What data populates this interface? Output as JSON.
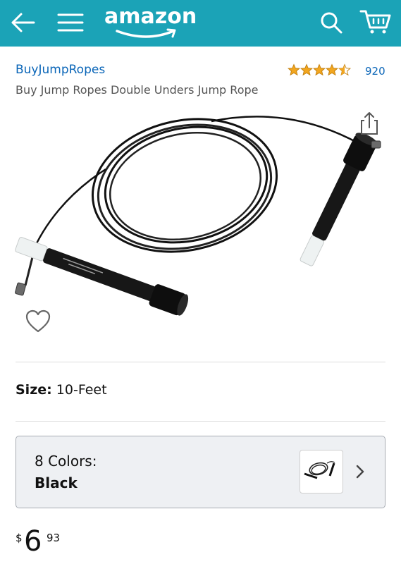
{
  "header": {
    "logo_text": "amazon",
    "icons": [
      "back-arrow-icon",
      "hamburger-menu-icon",
      "search-icon",
      "cart-icon"
    ],
    "background_color": "#1ba3b7"
  },
  "product": {
    "brand": "BuyJumpRopes",
    "title": "Buy Jump Ropes Double Unders Jump Rope",
    "rating": 4.5,
    "rating_max": 5,
    "rating_count": "920"
  },
  "size": {
    "label": "Size:",
    "value": "10-Feet"
  },
  "colors": {
    "label": "8 Colors:",
    "selected": "Black"
  },
  "price": {
    "currency": "$",
    "whole": "6",
    "fraction": "93"
  },
  "colors_palette": {
    "accent_link": "#0b66b8",
    "star": "#f2a61f"
  }
}
